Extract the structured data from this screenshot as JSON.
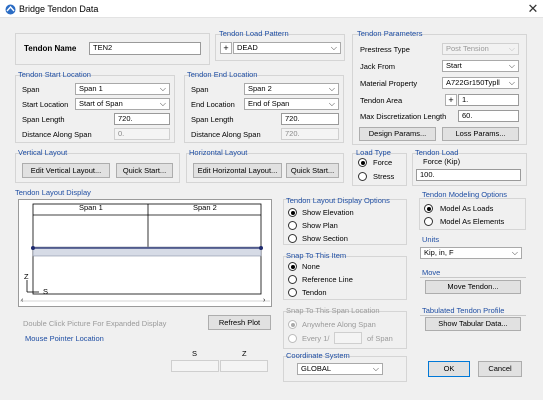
{
  "window": {
    "title": "Bridge Tendon Data",
    "close": "✕"
  },
  "tendon_name": {
    "label": "Tendon Name",
    "value": "TEN2"
  },
  "load_pattern": {
    "group": "Tendon Load Pattern",
    "plus": "+",
    "value": "DEAD"
  },
  "parameters": {
    "group": "Tendon Parameters",
    "prestress_type": {
      "label": "Prestress Type",
      "value": "Post Tension"
    },
    "jack_from": {
      "label": "Jack From",
      "value": "Start"
    },
    "material": {
      "label": "Material Property",
      "value": "A722Gr150Typll"
    },
    "area": {
      "label": "Tendon Area",
      "plus": "+",
      "value": "1."
    },
    "max_disc": {
      "label": "Max Discretization Length",
      "value": "60."
    },
    "design_btn": "Design Params...",
    "loss_btn": "Loss Params..."
  },
  "start_location": {
    "group": "Tendon Start Location",
    "span": {
      "label": "Span",
      "value": "Span 1"
    },
    "location": {
      "label": "Start Location",
      "value": "Start of Span"
    },
    "span_length": {
      "label": "Span Length",
      "value": "720."
    },
    "distance": {
      "label": "Distance Along Span",
      "value": "0."
    }
  },
  "end_location": {
    "group": "Tendon End Location",
    "span": {
      "label": "Span",
      "value": "Span 2"
    },
    "location": {
      "label": "End Location",
      "value": "End of Span"
    },
    "span_length": {
      "label": "Span Length",
      "value": "720."
    },
    "distance": {
      "label": "Distance Along Span",
      "value": "720."
    }
  },
  "vertical_layout": {
    "group": "Vertical Layout",
    "edit_btn": "Edit Vertical Layout...",
    "quick_btn": "Quick Start..."
  },
  "horizontal_layout": {
    "group": "Horizontal Layout",
    "edit_btn": "Edit Horizontal Layout...",
    "quick_btn": "Quick Start..."
  },
  "load_type": {
    "group": "Load Type",
    "force": "Force",
    "stress": "Stress",
    "selected": "Force"
  },
  "tendon_load": {
    "group": "Tendon Load",
    "label": "Force  (Kip)",
    "value": "100."
  },
  "layout_display": {
    "group": "Tendon Layout Display",
    "span1": "Span 1",
    "span2": "Span 2",
    "axis_z": "Z",
    "axis_s": "S",
    "hint": "Double Click Picture For Expanded Display",
    "refresh_btn": "Refresh Plot",
    "mouse_group": "Mouse Pointer Location",
    "col_s": "S",
    "col_z": "Z"
  },
  "display_options": {
    "group": "Tendon Layout Display Options",
    "options": [
      "Show Elevation",
      "Show Plan",
      "Show Section"
    ],
    "selected": "Show Elevation"
  },
  "snap_item": {
    "group": "Snap To This Item",
    "options": [
      "None",
      "Reference Line",
      "Tendon"
    ],
    "selected": "None"
  },
  "snap_span": {
    "group": "Snap To This Span Location",
    "anywhere": "Anywhere Along Span",
    "every": "Every 1/",
    "of_span": "of Span"
  },
  "coordinate_system": {
    "group": "Coordinate System",
    "value": "GLOBAL"
  },
  "modeling_options": {
    "group": "Tendon Modeling Options",
    "options": [
      "Model As Loads",
      "Model As Elements"
    ],
    "selected": "Model As Loads"
  },
  "units": {
    "group": "Units",
    "value": "Kip, in, F"
  },
  "move": {
    "group": "Move",
    "btn": "Move Tendon..."
  },
  "tabulated": {
    "group": "Tabulated Tendon Profile",
    "btn": "Show Tabular Data..."
  },
  "ok_btn": "OK",
  "cancel_btn": "Cancel",
  "colors": {
    "group_label": "#1f4ea3",
    "tendon_band": "#d6dbe6",
    "reference_line": "#1e2a6e",
    "window_bg": "#f0f0f0"
  }
}
